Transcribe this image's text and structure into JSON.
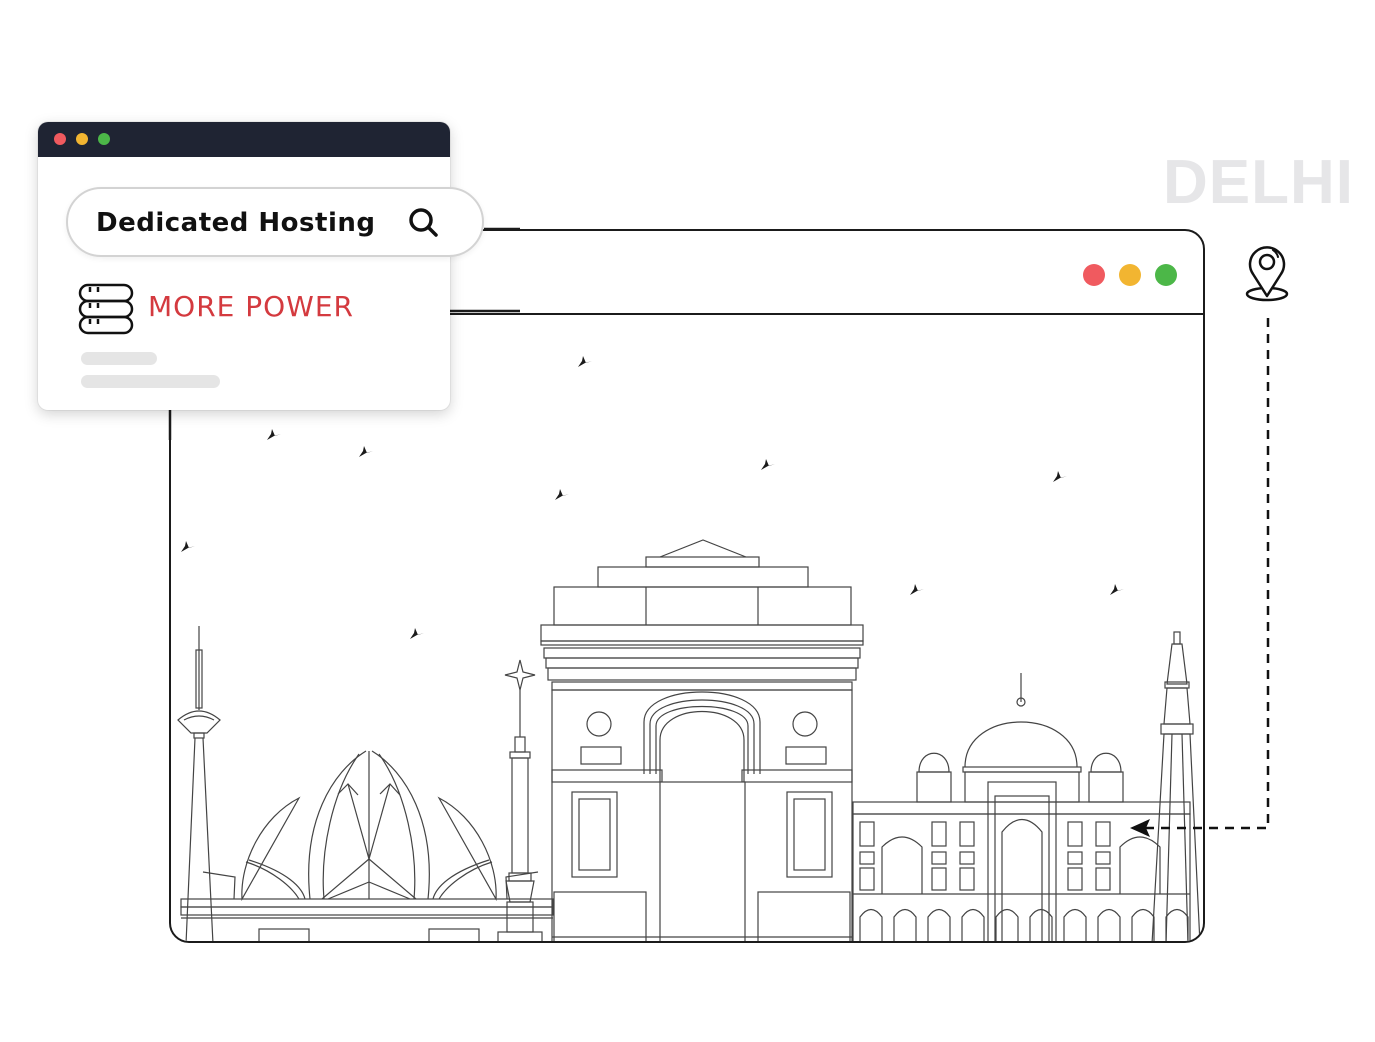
{
  "background_label": "DELHI",
  "search": {
    "value": "Dedicated Hosting",
    "icon": "search-icon"
  },
  "feature": {
    "icon": "server-stack-icon",
    "label": "MORE POWER"
  },
  "location": {
    "icon": "map-pin-icon"
  },
  "window_controls": {
    "close_color": "#f05a5f",
    "minimize_color": "#f2b531",
    "maximize_color": "#4cb748"
  },
  "colors": {
    "popup_titlebar": "#1f2433",
    "accent_red": "#d43a3f",
    "watermark": "#e6e6e8",
    "line": "#1b1b1b"
  },
  "illustration": {
    "landmarks": [
      "Pitampura TV Tower",
      "Lotus Temple",
      "Pillar",
      "India Gate",
      "Humayun's Tomb",
      "Qutub Minar"
    ],
    "birds": 11
  }
}
